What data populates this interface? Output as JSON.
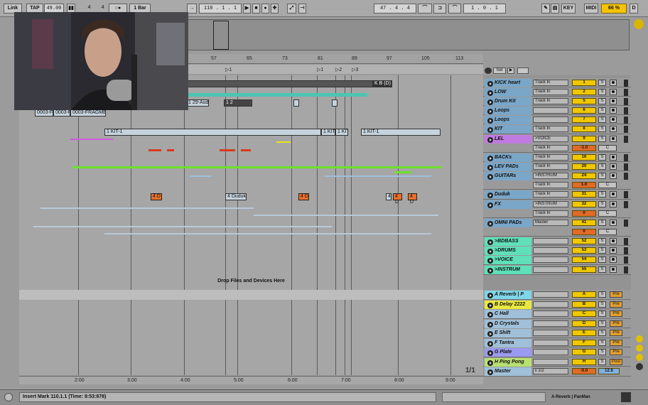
{
  "topbar": {
    "link": "Link",
    "tap": "TAP",
    "tempo": "49.00",
    "sig_num": "4",
    "sig_den": "4",
    "quant": "1 Bar",
    "arr_pos": "110 .  1 .  1",
    "punch_pos": "47 .  4 .  4",
    "loop_len": "1 .  0 .  1",
    "key": "KEY",
    "midi": "MIDI",
    "cpu": "66 %",
    "d": "D"
  },
  "ruler": {
    "ticks": [
      "57",
      "65",
      "73",
      "81",
      "89",
      "97",
      "105",
      "113"
    ]
  },
  "locators": [
    "1",
    "1",
    "2",
    "3"
  ],
  "clips": {
    "kb": "K B (D)",
    "aud": "1 29-Aud",
    "c1": "1 2",
    "frag1": "0003-F",
    "frag2": "0003-F",
    "frag3": "0003-FRAGME",
    "kit1": "1 KIT-1",
    "kit2": "1 KIT",
    "kit3": "1 KIT",
    "kit4": "1 KIT-1",
    "duduk1": "4 D",
    "duduk2": "4 Duduk",
    "duduk3": "4 D",
    "duduk4": "4",
    "duduk5": "4 D",
    "duduk6": "4 D"
  },
  "drop_text": "Drop Files and Devices Here",
  "set_label": "Set",
  "tracks": [
    {
      "name": "KICK heart",
      "in": "Track In",
      "num": "1"
    },
    {
      "name": "LOW",
      "in": "Track In",
      "num": "2"
    },
    {
      "name": "Drum Kit",
      "in": "Track In",
      "num": "5"
    },
    {
      "name": "Loops",
      "in": "",
      "num": "6"
    },
    {
      "name": "Loops",
      "in": "",
      "num": "7"
    },
    {
      "name": "KIT",
      "in": "Track In",
      "num": "8"
    },
    {
      "name": "LEL",
      "in": ">VOICE",
      "num": "9",
      "in2": "Track In",
      "num2": "-1.0"
    },
    {
      "name": "BACKs",
      "in": "Track In",
      "num": "16"
    },
    {
      "name": "LEV PADs",
      "in": "Track In",
      "num": "20"
    },
    {
      "name": "GUITARs",
      "in": ">INSTRUM",
      "num": "24",
      "in2": "Track In",
      "num2": "1.0"
    },
    {
      "name": "Duduk",
      "in": "Track In",
      "num": "31"
    },
    {
      "name": "FX",
      "in": ">INSTRUM",
      "num": "32",
      "in2": "Track In",
      "num2": "0"
    },
    {
      "name": "OMNI PADs",
      "in": "Master",
      "num": "41",
      "num2": "0"
    },
    {
      "name": ">BDBASS",
      "in": "",
      "num": "52"
    },
    {
      "name": ">DRUMS",
      "in": "",
      "num": "53"
    },
    {
      "name": ">VOICE",
      "in": "",
      "num": "54"
    },
    {
      "name": ">INSTRUM",
      "in": "",
      "num": "55"
    }
  ],
  "returns": [
    {
      "name": "A Reverb | P",
      "num": "A",
      "btn": "Pre"
    },
    {
      "name": "B Delay 2222",
      "num": "B",
      "btn": "Pre"
    },
    {
      "name": "C Hall",
      "num": "C",
      "btn": "Pre"
    },
    {
      "name": "D Crystals",
      "num": "D",
      "btn": "Pre"
    },
    {
      "name": "E Shift",
      "num": "E",
      "btn": "Pre"
    },
    {
      "name": "F Tantra",
      "num": "F",
      "btn": "Pre"
    },
    {
      "name": "G Plate",
      "num": "G",
      "btn": "Pre"
    },
    {
      "name": "H Ping Pong",
      "num": "H",
      "btn": "Post"
    },
    {
      "name": "Master",
      "in": "ii 1/2",
      "num": "-0.0",
      "num2": "12.6"
    }
  ],
  "solo": "S",
  "cross": "C",
  "page_count": "1/1",
  "timeline": [
    "2:00",
    "3:00",
    "4:00",
    "5:00",
    "6:00",
    "7:00",
    "8:00",
    "9:00"
  ],
  "status_text": "Insert Mark 110.1.1 (Time: 8:53:878)",
  "status_right": "A-Reverb | PanMan"
}
